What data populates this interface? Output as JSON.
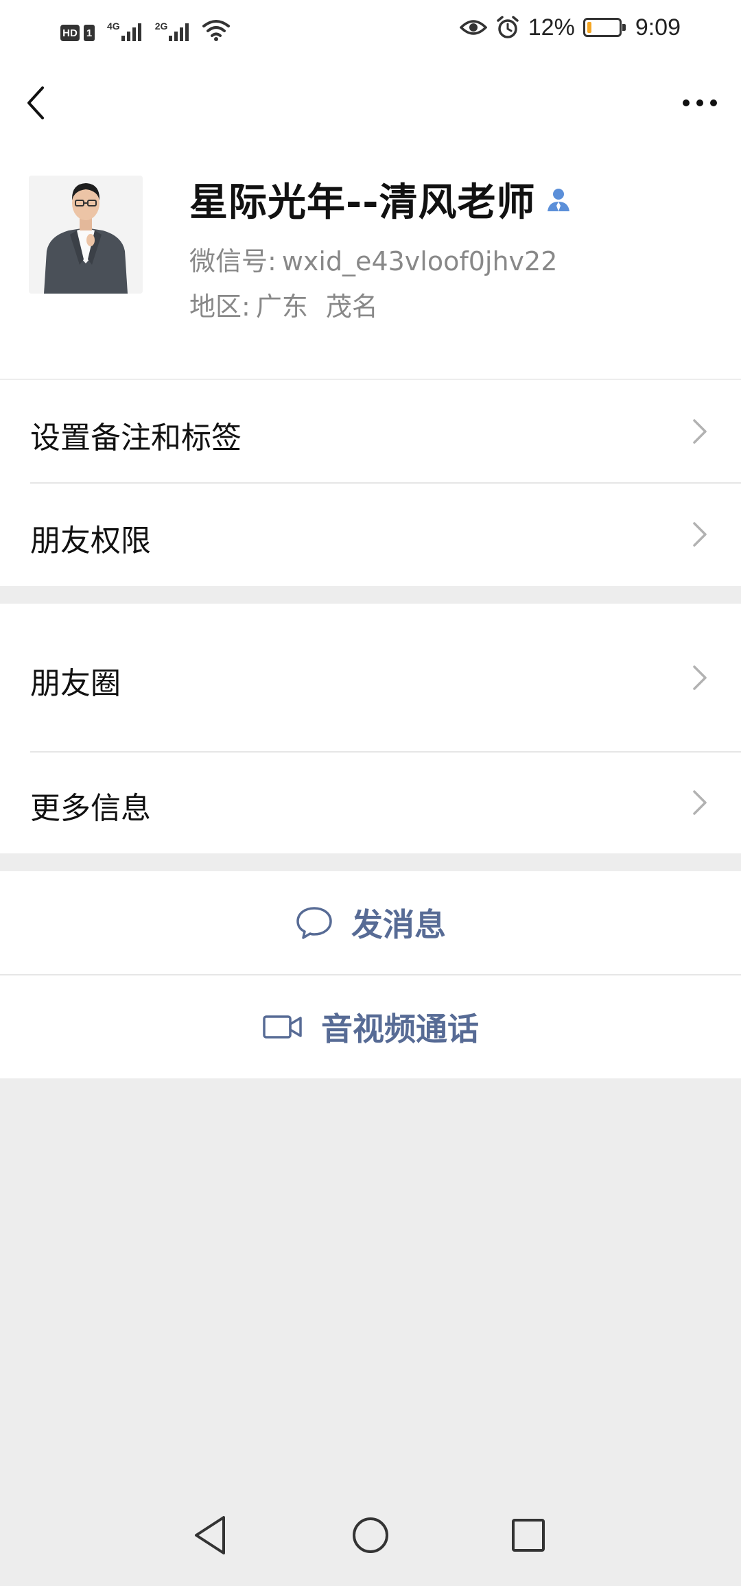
{
  "status_bar": {
    "hd": "HD",
    "sim": "1",
    "net1": "4G",
    "net2": "2G",
    "battery_pct": "12%",
    "battery_level": 0.12,
    "time": "9:09",
    "icons": [
      "eye-icon",
      "alarm-icon",
      "wifi-icon",
      "signal-icon",
      "battery-icon"
    ]
  },
  "header": {
    "back_icon": "chevron-left-icon",
    "more_icon": "ellipsis-icon"
  },
  "profile": {
    "name": "星际光年--清风老师",
    "contact_badge_icon": "person-icon",
    "wxid_label": "微信号:",
    "wxid_value": "wxid_e43vloof0jhv22",
    "region_label": "地区:",
    "region_province": "广东",
    "region_city": "茂名"
  },
  "menu": {
    "remark_tags": "设置备注和标签",
    "friend_permissions": "朋友权限",
    "moments": "朋友圈",
    "more_info": "更多信息"
  },
  "actions": {
    "send_message": "发消息",
    "av_call": "音视频通话"
  },
  "colors": {
    "link": "#576b95",
    "background": "#ededed",
    "badge_blue": "#5b8fd9",
    "battery_fill": "#f5a623"
  }
}
